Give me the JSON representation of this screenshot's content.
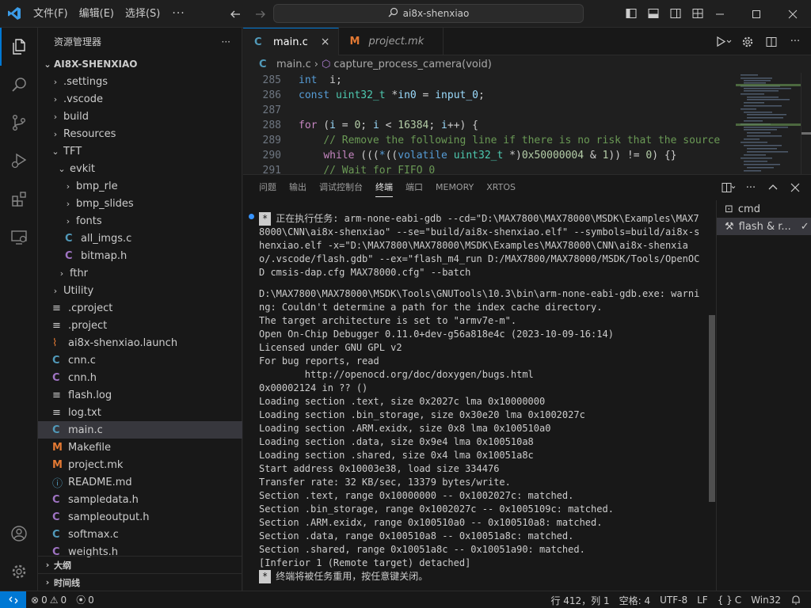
{
  "titlebar": {
    "menu": [
      "文件(F)",
      "编辑(E)",
      "选择(S)"
    ],
    "more": "···",
    "search": "ai8x-shenxiao"
  },
  "sidebar": {
    "title": "资源管理器",
    "more": "···",
    "root": "AI8X-SHENXIAO",
    "items": [
      {
        "label": ".settings",
        "depth": 0,
        "chev": "›",
        "icon": ""
      },
      {
        "label": ".vscode",
        "depth": 0,
        "chev": "›",
        "icon": ""
      },
      {
        "label": "build",
        "depth": 0,
        "chev": "›",
        "icon": ""
      },
      {
        "label": "Resources",
        "depth": 0,
        "chev": "›",
        "icon": ""
      },
      {
        "label": "TFT",
        "depth": 0,
        "chev": "⌄",
        "icon": ""
      },
      {
        "label": "evkit",
        "depth": 1,
        "chev": "⌄",
        "icon": ""
      },
      {
        "label": "bmp_rle",
        "depth": 2,
        "chev": "›",
        "icon": ""
      },
      {
        "label": "bmp_slides",
        "depth": 2,
        "chev": "›",
        "icon": ""
      },
      {
        "label": "fonts",
        "depth": 2,
        "chev": "›",
        "icon": ""
      },
      {
        "label": "all_imgs.c",
        "depth": 2,
        "chev": "",
        "icon": "C",
        "type": "c"
      },
      {
        "label": "bitmap.h",
        "depth": 2,
        "chev": "",
        "icon": "C",
        "type": "h"
      },
      {
        "label": "fthr",
        "depth": 1,
        "chev": "›",
        "icon": ""
      },
      {
        "label": "Utility",
        "depth": 0,
        "chev": "›",
        "icon": ""
      },
      {
        "label": ".cproject",
        "depth": 0,
        "chev": "",
        "icon": "≡",
        "type": "lines"
      },
      {
        "label": ".project",
        "depth": 0,
        "chev": "",
        "icon": "≡",
        "type": "lines"
      },
      {
        "label": "ai8x-shenxiao.launch",
        "depth": 0,
        "chev": "",
        "icon": "⌇",
        "type": "rss"
      },
      {
        "label": "cnn.c",
        "depth": 0,
        "chev": "",
        "icon": "C",
        "type": "c"
      },
      {
        "label": "cnn.h",
        "depth": 0,
        "chev": "",
        "icon": "C",
        "type": "h"
      },
      {
        "label": "flash.log",
        "depth": 0,
        "chev": "",
        "icon": "≡",
        "type": "lines"
      },
      {
        "label": "log.txt",
        "depth": 0,
        "chev": "",
        "icon": "≡",
        "type": "lines"
      },
      {
        "label": "main.c",
        "depth": 0,
        "chev": "",
        "icon": "C",
        "type": "c",
        "selected": true
      },
      {
        "label": "Makefile",
        "depth": 0,
        "chev": "",
        "icon": "M",
        "type": "m"
      },
      {
        "label": "project.mk",
        "depth": 0,
        "chev": "",
        "icon": "M",
        "type": "m"
      },
      {
        "label": "README.md",
        "depth": 0,
        "chev": "",
        "icon": "ⓘ",
        "type": "info"
      },
      {
        "label": "sampledata.h",
        "depth": 0,
        "chev": "",
        "icon": "C",
        "type": "h"
      },
      {
        "label": "sampleoutput.h",
        "depth": 0,
        "chev": "",
        "icon": "C",
        "type": "h"
      },
      {
        "label": "softmax.c",
        "depth": 0,
        "chev": "",
        "icon": "C",
        "type": "c"
      },
      {
        "label": "weights.h",
        "depth": 0,
        "chev": "",
        "icon": "C",
        "type": "h"
      }
    ],
    "outline": "大纲",
    "timeline": "时间线"
  },
  "editor": {
    "tabs": [
      {
        "label": "main.c",
        "icon": "C",
        "active": true
      },
      {
        "label": "project.mk",
        "icon": "M",
        "active": false
      }
    ],
    "breadcrumb": {
      "file": "main.c",
      "symbol": "capture_process_camera(void)"
    },
    "lines": [
      {
        "n": "285",
        "indent": "",
        "tokens": [
          [
            "kw",
            "int"
          ],
          [
            "",
            "  i;"
          ]
        ]
      },
      {
        "n": "286",
        "indent": "",
        "tokens": [
          [
            "kw",
            "const"
          ],
          [
            "",
            " "
          ],
          [
            "ty",
            "uint32_t"
          ],
          [
            "",
            " *"
          ],
          [
            "var",
            "in0"
          ],
          [
            "",
            " = "
          ],
          [
            "var",
            "input_0"
          ],
          [
            "",
            ";"
          ]
        ]
      },
      {
        "n": "287",
        "indent": "",
        "tokens": []
      },
      {
        "n": "288",
        "indent": "",
        "tokens": [
          [
            "kw2",
            "for"
          ],
          [
            "",
            " ("
          ],
          [
            "var",
            "i"
          ],
          [
            "",
            " = "
          ],
          [
            "num",
            "0"
          ],
          [
            "",
            "; "
          ],
          [
            "var",
            "i"
          ],
          [
            "",
            " < "
          ],
          [
            "num",
            "16384"
          ],
          [
            "",
            "; "
          ],
          [
            "var",
            "i"
          ],
          [
            "",
            "++) {"
          ]
        ]
      },
      {
        "n": "289",
        "indent": "    ",
        "tokens": [
          [
            "cm",
            "// Remove the following line if there is no risk that the source"
          ]
        ]
      },
      {
        "n": "290",
        "indent": "    ",
        "tokens": [
          [
            "kw2",
            "while"
          ],
          [
            "",
            " ((("
          ],
          [
            "kw",
            "*"
          ],
          [
            "",
            "(("
          ],
          [
            "kw",
            "volatile"
          ],
          [
            "",
            " "
          ],
          [
            "ty",
            "uint32_t"
          ],
          [
            "",
            " *)"
          ],
          [
            "num",
            "0x50000004"
          ],
          [
            "",
            " & "
          ],
          [
            "num",
            "1"
          ],
          [
            "",
            ")) != "
          ],
          [
            "num",
            "0"
          ],
          [
            "",
            ") {}"
          ]
        ]
      },
      {
        "n": "291",
        "indent": "    ",
        "tokens": [
          [
            "cm",
            "// Wait for FIFO 0"
          ]
        ]
      }
    ]
  },
  "panel": {
    "tabs": [
      "问题",
      "输出",
      "调试控制台",
      "终端",
      "端口",
      "MEMORY",
      "XRTOS"
    ],
    "active_tab": "终端",
    "terminals": [
      {
        "label": "cmd",
        "icon": "⊡",
        "active": false
      },
      {
        "label": "flash & r...",
        "icon": "⚒",
        "active": true,
        "check": "✓"
      }
    ],
    "task_badge": "*",
    "task_line": "正在执行任务: arm-none-eabi-gdb --cd=\"D:\\MAX7800\\MAX78000\\MSDK\\Examples\\MAX78000\\CNN\\ai8x-shenxiao\" --se=\"build/ai8x-shenxiao.elf\" --symbols=build/ai8x-shenxiao.elf -x=\"D:\\MAX7800\\MAX78000\\MSDK\\Examples\\MAX78000\\CNN\\ai8x-shenxiao/.vscode/flash.gdb\" --ex=\"flash_m4_run D:/MAX7800/MAX78000/MSDK/Tools/OpenOCD cmsis-dap.cfg MAX78000.cfg\" --batch",
    "output_lines": [
      "D:\\MAX7800\\MAX78000\\MSDK\\Tools\\GNUTools\\10.3\\bin\\arm-none-eabi-gdb.exe: warning: Couldn't determine a path for the index cache directory.",
      "The target architecture is set to \"armv7e-m\".",
      "Open On-Chip Debugger 0.11.0+dev-g56a818e4c (2023-10-09-16:14)",
      "Licensed under GNU GPL v2",
      "For bug reports, read",
      "        http://openocd.org/doc/doxygen/bugs.html",
      "0x00002124 in ?? ()",
      "Loading section .text, size 0x2027c lma 0x10000000",
      "Loading section .bin_storage, size 0x30e20 lma 0x1002027c",
      "Loading section .ARM.exidx, size 0x8 lma 0x100510a0",
      "Loading section .data, size 0x9e4 lma 0x100510a8",
      "Loading section .shared, size 0x4 lma 0x10051a8c",
      "Start address 0x10003e38, load size 334476",
      "Transfer rate: 32 KB/sec, 13379 bytes/write.",
      "Section .text, range 0x10000000 -- 0x1002027c: matched.",
      "Section .bin_storage, range 0x1002027c -- 0x1005109c: matched.",
      "Section .ARM.exidx, range 0x100510a0 -- 0x100510a8: matched.",
      "Section .data, range 0x100510a8 -- 0x10051a8c: matched.",
      "Section .shared, range 0x10051a8c -- 0x10051a90: matched.",
      "[Inferior 1 (Remote target) detached]"
    ],
    "end_line": "终端将被任务重用，按任意键关闭。"
  },
  "statusbar": {
    "errors": "0",
    "warnings": "0",
    "ports": "0",
    "position": "行 412，列 1",
    "spaces": "空格: 4",
    "encoding": "UTF-8",
    "eol": "LF",
    "language": "C",
    "platform": "Win32"
  }
}
